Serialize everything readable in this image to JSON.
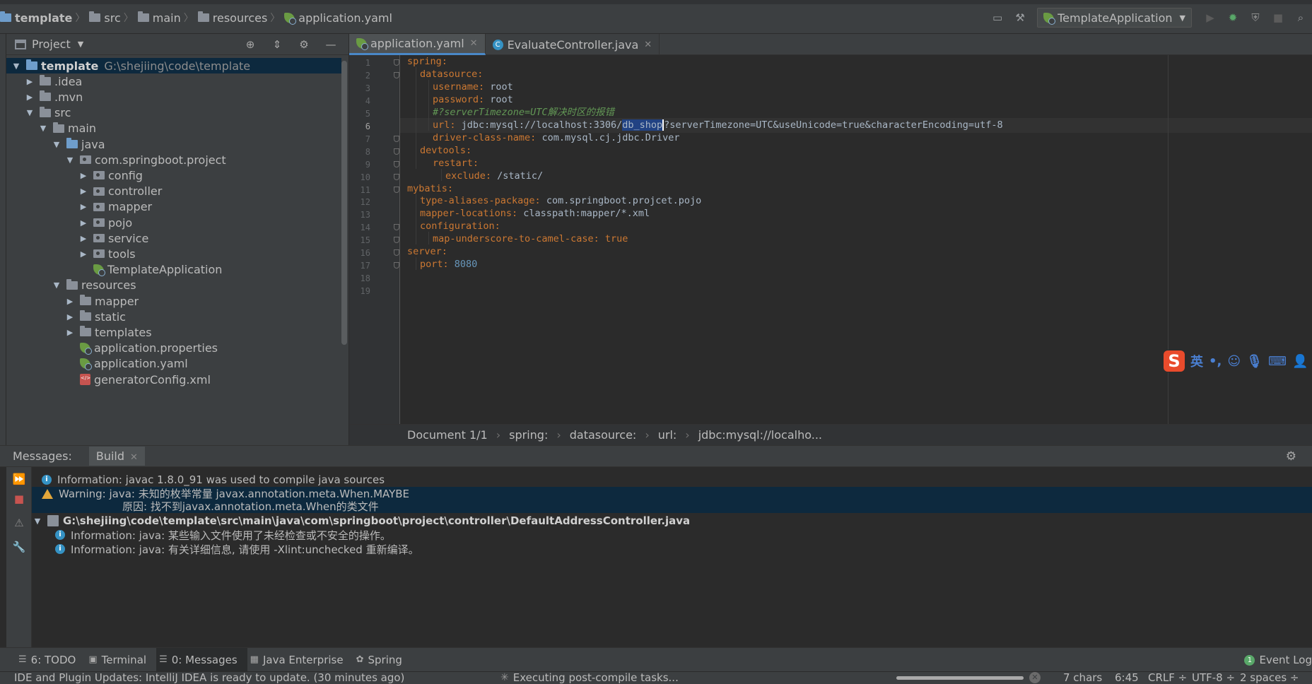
{
  "breadcrumb": [
    "template",
    "src",
    "main",
    "resources",
    "application.yaml"
  ],
  "run_config": "TemplateApplication",
  "project_panel": {
    "title": "Project",
    "tree": [
      {
        "label": "template",
        "extra": "G:\\shejiing\\code\\template",
        "depth": 0,
        "toggle": "open",
        "icon": "folder-blue",
        "bold": true,
        "selected": true
      },
      {
        "label": ".idea",
        "depth": 1,
        "toggle": "closed",
        "icon": "folder"
      },
      {
        "label": ".mvn",
        "depth": 1,
        "toggle": "closed",
        "icon": "folder"
      },
      {
        "label": "src",
        "depth": 1,
        "toggle": "open",
        "icon": "folder"
      },
      {
        "label": "main",
        "depth": 2,
        "toggle": "open",
        "icon": "folder"
      },
      {
        "label": "java",
        "depth": 3,
        "toggle": "open",
        "icon": "folder-blue"
      },
      {
        "label": "com.springboot.project",
        "depth": 4,
        "toggle": "open",
        "icon": "package"
      },
      {
        "label": "config",
        "depth": 5,
        "toggle": "closed",
        "icon": "package"
      },
      {
        "label": "controller",
        "depth": 5,
        "toggle": "closed",
        "icon": "package"
      },
      {
        "label": "mapper",
        "depth": 5,
        "toggle": "closed",
        "icon": "package"
      },
      {
        "label": "pojo",
        "depth": 5,
        "toggle": "closed",
        "icon": "package"
      },
      {
        "label": "service",
        "depth": 5,
        "toggle": "closed",
        "icon": "package"
      },
      {
        "label": "tools",
        "depth": 5,
        "toggle": "closed",
        "icon": "package"
      },
      {
        "label": "TemplateApplication",
        "depth": 5,
        "toggle": "none",
        "icon": "spring"
      },
      {
        "label": "resources",
        "depth": 3,
        "toggle": "open",
        "icon": "folder"
      },
      {
        "label": "mapper",
        "depth": 4,
        "toggle": "closed",
        "icon": "folder"
      },
      {
        "label": "static",
        "depth": 4,
        "toggle": "closed",
        "icon": "folder"
      },
      {
        "label": "templates",
        "depth": 4,
        "toggle": "closed",
        "icon": "folder"
      },
      {
        "label": "application.properties",
        "depth": 4,
        "toggle": "none",
        "icon": "spring"
      },
      {
        "label": "application.yaml",
        "depth": 4,
        "toggle": "none",
        "icon": "spring"
      },
      {
        "label": "generatorConfig.xml",
        "depth": 4,
        "toggle": "none",
        "icon": "xml"
      }
    ]
  },
  "editor": {
    "tabs": [
      {
        "label": "application.yaml",
        "active": true,
        "icon": "spring"
      },
      {
        "label": "EvaluateController.java",
        "active": false,
        "icon": "class"
      }
    ],
    "lines": [
      {
        "n": "1",
        "indent": 0,
        "key": "spring:",
        "value": ""
      },
      {
        "n": "2",
        "indent": 1,
        "key": "datasource:",
        "value": ""
      },
      {
        "n": "3",
        "indent": 2,
        "key": "username:",
        "value": " root"
      },
      {
        "n": "4",
        "indent": 2,
        "key": "password:",
        "value": " root"
      },
      {
        "n": "5",
        "indent": 2,
        "comment": "#?serverTimezone=UTC解决时区的报错"
      },
      {
        "n": "6",
        "indent": 2,
        "key": "url:",
        "value_pre": " jdbc:mysql://localhost:3306/",
        "value_sel": "db_shop",
        "value_post": "?serverTimezone=UTC&useUnicode=true&characterEncoding=utf-8",
        "current": true
      },
      {
        "n": "7",
        "indent": 2,
        "key": "driver-class-name:",
        "value": " com.mysql.cj.jdbc.Driver"
      },
      {
        "n": "8",
        "indent": 1,
        "key": "devtools:",
        "value": ""
      },
      {
        "n": "9",
        "indent": 2,
        "key": "restart:",
        "value": ""
      },
      {
        "n": "10",
        "indent": 3,
        "key": "exclude:",
        "value": " /static/"
      },
      {
        "n": "11",
        "indent": 0,
        "key": "mybatis:",
        "value": ""
      },
      {
        "n": "12",
        "indent": 1,
        "key": "type-aliases-package:",
        "value": " com.springboot.projcet.pojo"
      },
      {
        "n": "13",
        "indent": 1,
        "key": "mapper-locations:",
        "value": " classpath:mapper/*.xml"
      },
      {
        "n": "14",
        "indent": 1,
        "key": "configuration:",
        "value": ""
      },
      {
        "n": "15",
        "indent": 2,
        "key": "map-underscore-to-camel-case:",
        "value": " ",
        "keyword": "true"
      },
      {
        "n": "16",
        "indent": 0,
        "key": "server:",
        "value": ""
      },
      {
        "n": "17",
        "indent": 1,
        "key": "port:",
        "value": " ",
        "number": "8080"
      },
      {
        "n": "18",
        "indent": 0,
        "key": "",
        "value": ""
      },
      {
        "n": "19",
        "indent": 0,
        "key": "",
        "value": ""
      }
    ],
    "breadcrumb": [
      "Document 1/1",
      "spring:",
      "datasource:",
      "url:",
      "jdbc:mysql://localho..."
    ],
    "ime": {
      "logo": "S",
      "mode": "英"
    }
  },
  "messages": {
    "title": "Messages:",
    "tab": "Build",
    "items": [
      {
        "type": "info",
        "text": "Information: javac 1.8.0_91 was used to compile java sources",
        "indent": 0
      },
      {
        "type": "warning",
        "text": "Warning: java: 未知的枚举常量 javax.annotation.meta.When.MAYBE",
        "indent": 0,
        "highlight": true
      },
      {
        "type": "warning-detail",
        "text": "原因: 找不到javax.annotation.meta.When的类文件",
        "indent": 0,
        "highlight": true
      },
      {
        "type": "file",
        "text": "G:\\shejiing\\code\\template\\src\\main\\java\\com\\springboot\\project\\controller\\DefaultAddressController.java",
        "indent": 0
      },
      {
        "type": "info",
        "text": "Information: java: 某些输入文件使用了未经检查或不安全的操作。",
        "indent": 1
      },
      {
        "type": "info",
        "text": "Information: java: 有关详细信息, 请使用 -Xlint:unchecked 重新编译。",
        "indent": 1
      }
    ]
  },
  "tool_tabs": [
    {
      "label": "6: TODO",
      "icon": "☰",
      "active": false
    },
    {
      "label": "Terminal",
      "icon": "▣",
      "active": false
    },
    {
      "label": "0: Messages",
      "icon": "☰",
      "active": true
    },
    {
      "label": "Java Enterprise",
      "icon": "▦",
      "active": false
    },
    {
      "label": "Spring",
      "icon": "✿",
      "active": false
    }
  ],
  "event_log": "Event Log",
  "status_bar": {
    "message": "IDE and Plugin Updates: IntelliJ IDEA is ready to update. (30 minutes ago)",
    "task": "Executing post-compile tasks...",
    "progress": 1.0,
    "chars": "7 chars",
    "position": "6:45",
    "line_sep": "CRLF ÷",
    "encoding": "UTF-8 ÷",
    "indent": "2 spaces ÷"
  },
  "colors": {
    "accent": "#4a88c7",
    "selection": "#214283",
    "keyword": "#cc7832",
    "comment": "#629755",
    "number": "#6897bb"
  }
}
